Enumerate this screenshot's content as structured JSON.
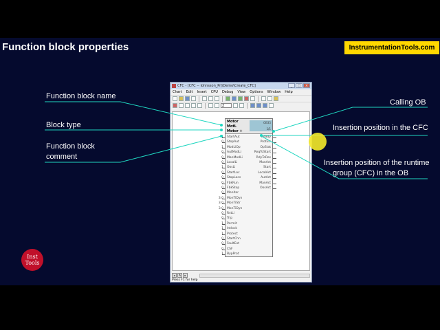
{
  "slide": {
    "title": "Function block properties",
    "site": "InstrumentationTools.com",
    "logo": {
      "line1": "Inst",
      "line2": "Tools"
    },
    "labels": {
      "fb_name": "Function block name",
      "block_type": "Block type",
      "fb_comment_1": "Function block",
      "fb_comment_2": "comment",
      "calling_ob": "Calling OB",
      "ins_pos_cfc": "Insertion position in the CFC",
      "ins_pos_rt_1": "Insertion position of the runtime",
      "ins_pos_rt_2": "group (CFC) in the OB"
    }
  },
  "window": {
    "title": "CFC - [CFC -- Iohnsson_Prj\\Demo\\Create_CFC]",
    "controls": [
      "_",
      "□",
      "×"
    ],
    "menu": [
      "Chart",
      "Edit",
      "Insert",
      "CPU",
      "Debug",
      "View",
      "Options",
      "Window",
      "Help"
    ],
    "zoom": "2",
    "status": "Press F1 for help",
    "sheet_tab": "A"
  },
  "block": {
    "name": "Motor",
    "type": "MotL",
    "comment": "Motor +",
    "calling_ob": "OB35",
    "insertion": "1/1",
    "inputs": [
      {
        "value": "1",
        "name": "StartAut"
      },
      {
        "value": "0",
        "name": "StopAut"
      },
      {
        "value": "1",
        "name": "ModLiOp"
      },
      {
        "value": "0",
        "name": "AutModLi"
      },
      {
        "value": "0",
        "name": "ManModLi"
      },
      {
        "value": "0",
        "name": "LocalLi"
      },
      {
        "value": "1",
        "name": "OosLi"
      },
      {
        "value": "0",
        "name": "StartLoc"
      },
      {
        "value": "0",
        "name": "StopLocs"
      },
      {
        "value": "0",
        "name": "FbkRun"
      },
      {
        "value": "0",
        "name": "FbkStop"
      },
      {
        "value": "0",
        "name": "Monitor"
      },
      {
        "value": "3.0",
        "name": "MonTiDyn"
      },
      {
        "value": "3.0",
        "name": "MonTiStr"
      },
      {
        "value": "3.0",
        "name": "MonTiDyn"
      },
      {
        "value": "0",
        "name": "RstLi"
      },
      {
        "value": "0",
        "name": "Trip"
      },
      {
        "value": "1",
        "name": "Permit"
      },
      {
        "value": "1",
        "name": "Intlock"
      },
      {
        "value": "1",
        "name": "Protect"
      },
      {
        "value": "0",
        "name": "StartChn"
      },
      {
        "value": "0",
        "name": "FaultExt"
      },
      {
        "value": "0",
        "name": "CSF"
      },
      {
        "value": "1",
        "name": "BypProt"
      }
    ],
    "outputs": [
      "Ready",
      "ProtErr",
      "OpStat",
      "ReqToStart",
      "RdyToRes",
      "ManAct",
      "Start",
      "LocalAct",
      "AutAct",
      "ManAct",
      "OosAct"
    ]
  }
}
